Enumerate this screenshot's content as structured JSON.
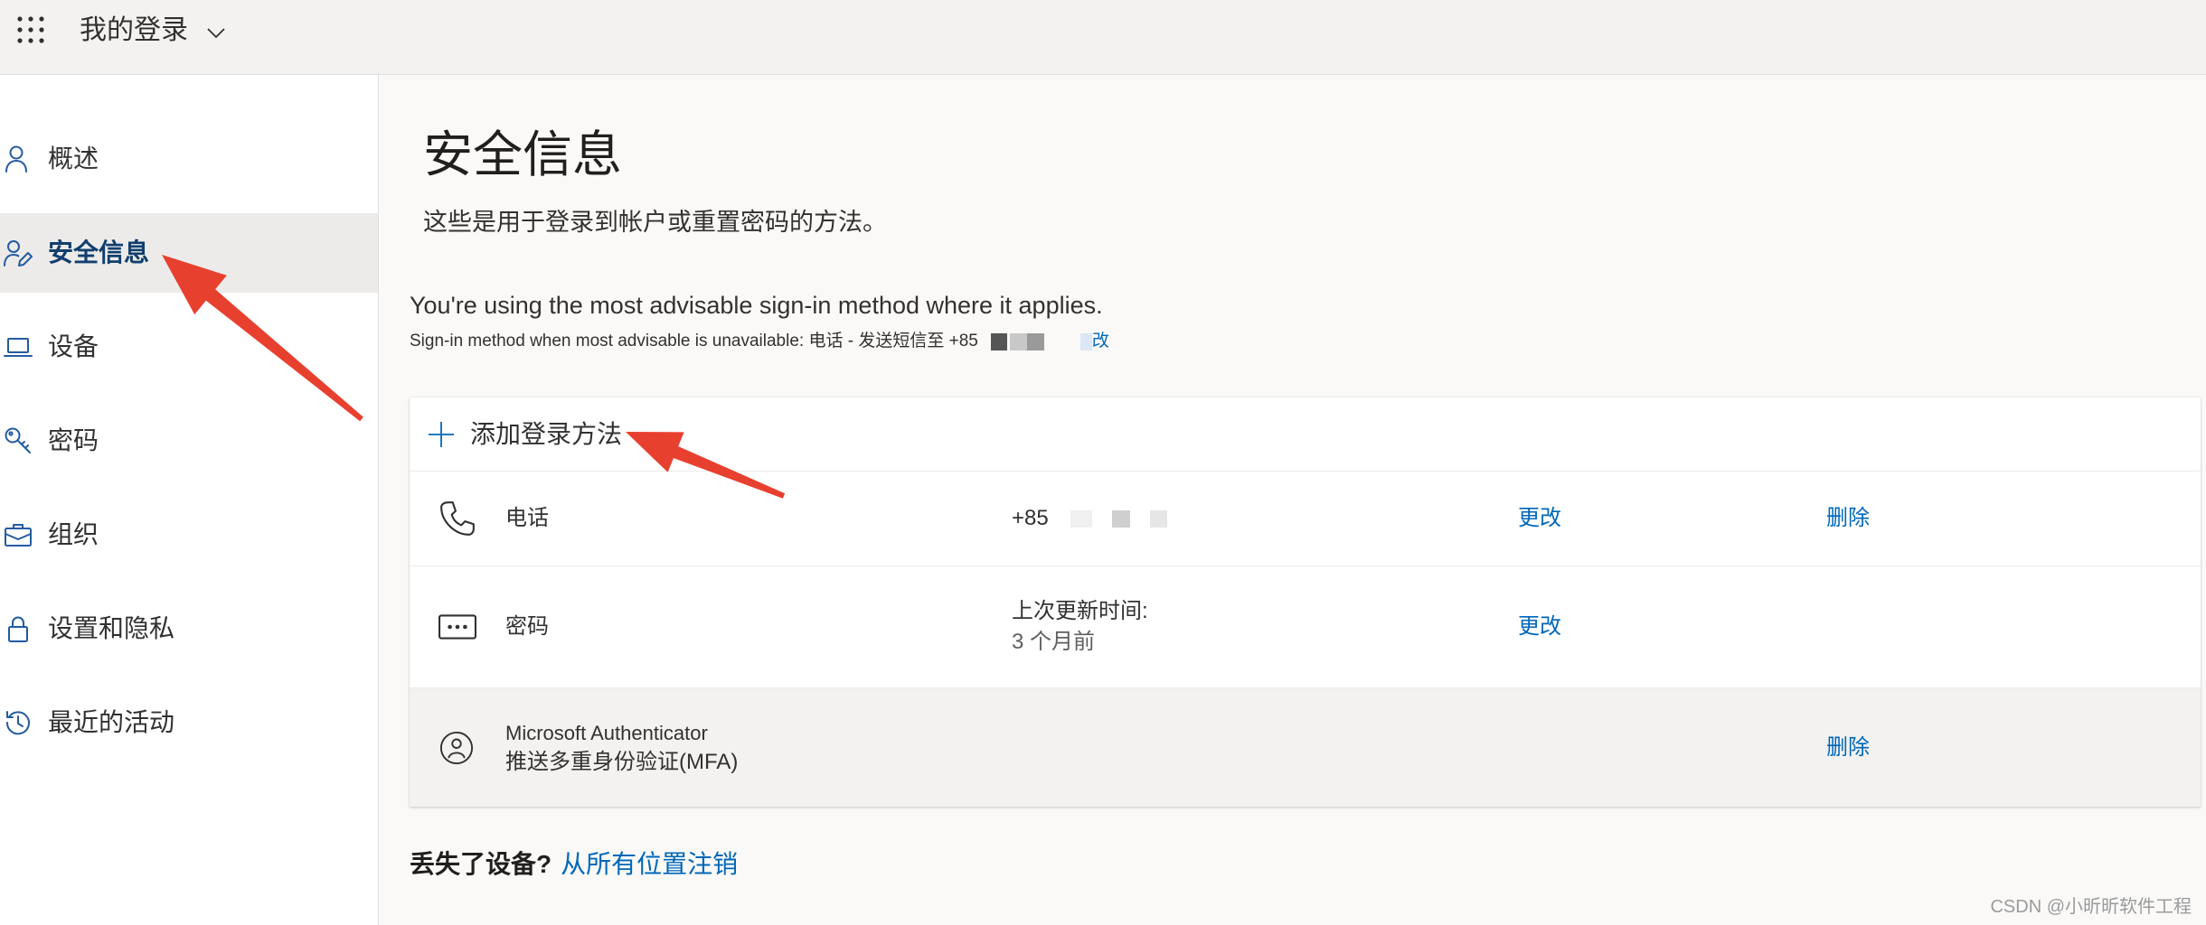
{
  "header": {
    "app_title": "我的登录",
    "icons": {
      "menu": "waffle-icon",
      "dropdown": "chevron-down-icon"
    }
  },
  "sidebar": {
    "items": [
      {
        "label": "概述",
        "icon": "person-icon",
        "selected": false
      },
      {
        "label": "安全信息",
        "icon": "person-edit-icon",
        "selected": true
      },
      {
        "label": "设备",
        "icon": "laptop-icon",
        "selected": false
      },
      {
        "label": "密码",
        "icon": "key-icon",
        "selected": false
      },
      {
        "label": "组织",
        "icon": "briefcase-icon",
        "selected": false
      },
      {
        "label": "设置和隐私",
        "icon": "lock-icon",
        "selected": false
      },
      {
        "label": "最近的活动",
        "icon": "history-icon",
        "selected": false
      }
    ]
  },
  "main": {
    "title": "安全信息",
    "subtitle": "这些是用于登录到帐户或重置密码的方法。",
    "advisable_message": "You're using the most advisable sign-in method where it applies.",
    "fallback": {
      "text": "Sign-in method when most advisable is unavailable: 电话 - 发送短信至 +85",
      "link": "改"
    },
    "add_method": {
      "label": "添加登录方法",
      "icon": "plus-icon"
    },
    "methods": [
      {
        "name": "电话",
        "icon": "phone-icon",
        "detail": [
          "+85"
        ],
        "change_label": "更改",
        "delete_label": "删除"
      },
      {
        "name": "密码",
        "icon": "password-icon",
        "detail": [
          "上次更新时间:",
          "3 个月前"
        ],
        "change_label": "更改"
      },
      {
        "name": "Microsoft Authenticator",
        "subtitle": "推送多重身份验证(MFA)",
        "icon": "authenticator-icon",
        "delete_label": "删除"
      }
    ],
    "lost_device": {
      "question": "丢失了设备?",
      "link": "从所有位置注销"
    }
  },
  "watermark": "CSDN @小昕昕软件工程",
  "colors": {
    "accent": "#0067b8",
    "selected_nav_text": "#103f6e",
    "selected_nav_bg": "#edebe9",
    "nav_icon": "#255ba0",
    "annotation_arrow": "#e8402f"
  }
}
